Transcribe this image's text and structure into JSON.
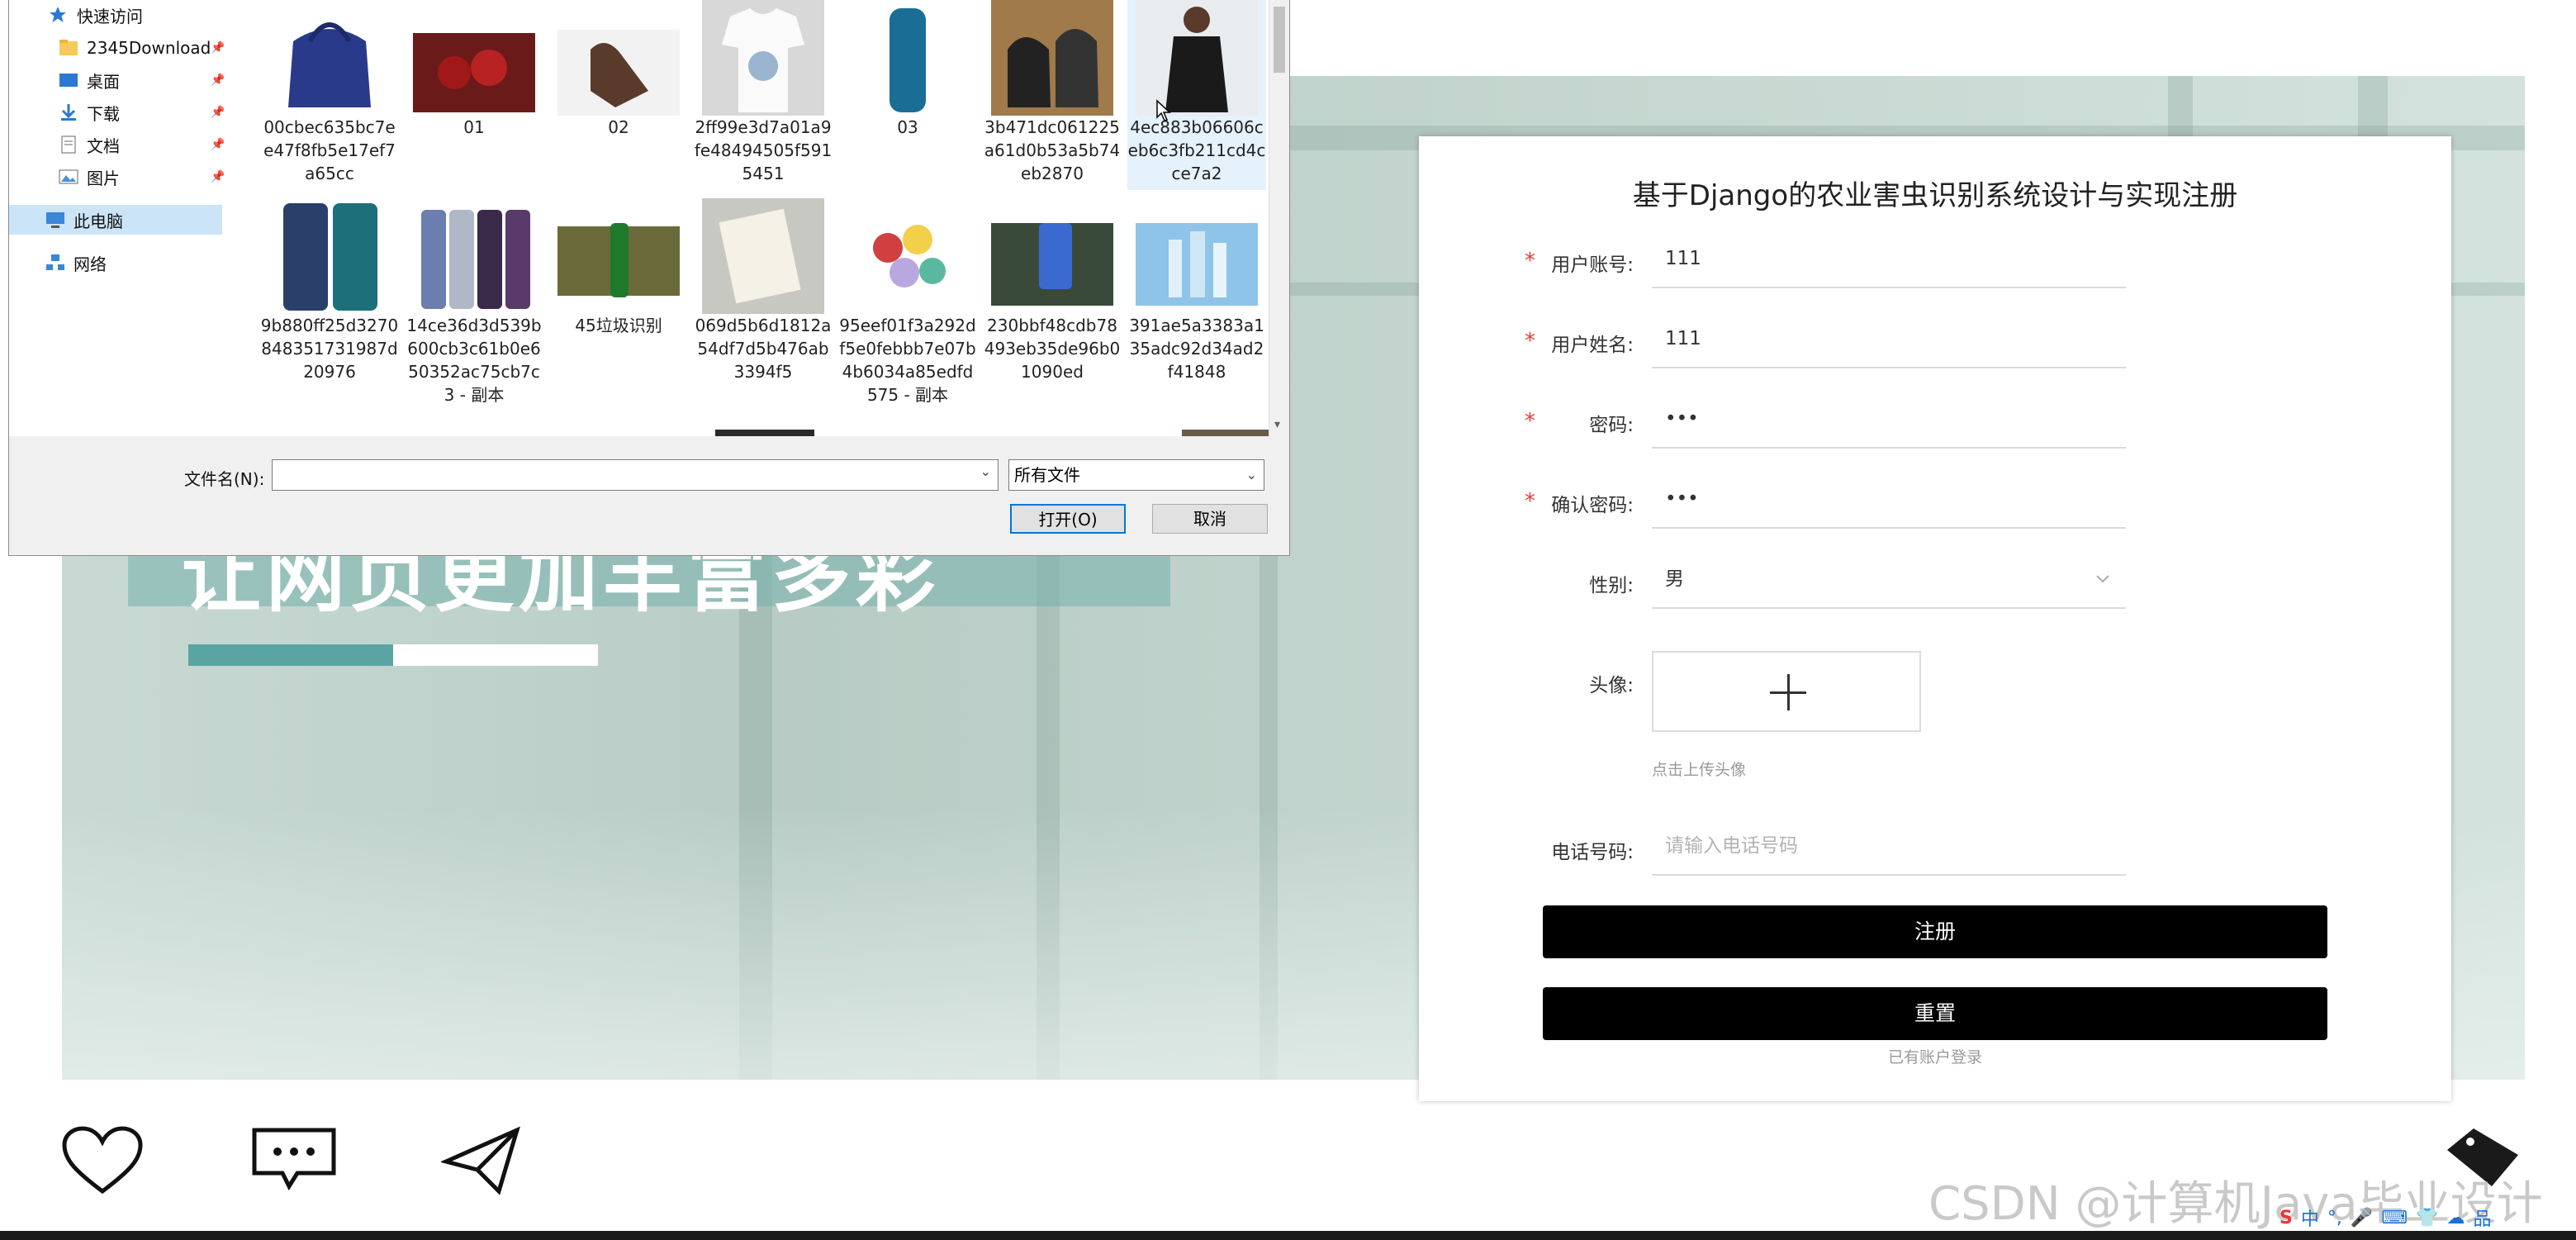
{
  "banner": {
    "slogan": "让网页更加丰富多彩"
  },
  "register": {
    "title": "基于Django的农业害虫识别系统设计与实现注册",
    "fields": [
      {
        "label": "用户账号:",
        "value": "111",
        "required": true
      },
      {
        "label": "用户姓名:",
        "value": "111",
        "required": true
      },
      {
        "label": "密码:",
        "value": "•••",
        "required": true
      },
      {
        "label": "确认密码:",
        "value": "•••",
        "required": true
      },
      {
        "label": "性别:",
        "value": "男",
        "required": false
      }
    ],
    "avatar_label": "头像:",
    "avatar_hint": "点击上传头像",
    "phone_label": "电话号码:",
    "phone_placeholder": "请输入电话号码",
    "register_button": "注册",
    "reset_button": "重置",
    "login_link": "已有账户登录"
  },
  "dialog": {
    "nav": [
      {
        "label": "快速访问",
        "icon": "star-icon"
      },
      {
        "label": "2345Download",
        "icon": "folder-icon",
        "pinned": true
      },
      {
        "label": "桌面",
        "icon": "desktop-icon",
        "pinned": true
      },
      {
        "label": "下载",
        "icon": "download-icon",
        "pinned": true
      },
      {
        "label": "文档",
        "icon": "document-icon",
        "pinned": true
      },
      {
        "label": "图片",
        "icon": "picture-icon",
        "pinned": true
      },
      {
        "label": "此电脑",
        "icon": "computer-icon"
      },
      {
        "label": "网络",
        "icon": "network-icon"
      }
    ],
    "files": [
      {
        "name": "00cbec635bc7ee47f8fb5e17ef7a65cc",
        "thumb": "handbag"
      },
      {
        "name": "01",
        "thumb": "cherries"
      },
      {
        "name": "02",
        "thumb": "massage-chair"
      },
      {
        "name": "2ff99e3d7a01a9fe48494505f5915451",
        "thumb": "tshirt"
      },
      {
        "name": "03",
        "thumb": "bottle"
      },
      {
        "name": "3b471dc061225a61d0b53a5b74eb2870",
        "thumb": "shoes"
      },
      {
        "name": "4ec883b06606ceb6c3fb211cd4cce7a2",
        "thumb": "dress",
        "selected": true
      },
      {
        "name": "9b880ff25d3270848351731987d20976",
        "thumb": "phone-case"
      },
      {
        "name": "14ce36d3d539b600cb3c61b0e650352ac75cb7c3 - 副本",
        "thumb": "phones"
      },
      {
        "name": "45垃圾识别",
        "thumb": "green-bottle"
      },
      {
        "name": "069d5b6d1812a54df7d5b476ab3394f5",
        "thumb": "notebooks"
      },
      {
        "name": "95eef01f3a292df5e0febbb7e07b4b6034a85edfd575 - 副本",
        "thumb": "iphones"
      },
      {
        "name": "230bbf48cdb78493eb35de96b01090ed",
        "thumb": "hand-phone"
      },
      {
        "name": "391ae5a3383a135adc92d34ad2f41848",
        "thumb": "cosmetics"
      }
    ],
    "filename_label": "文件名(N):",
    "filename_value": "",
    "filetype_value": "所有文件",
    "open_button": "打开(O)",
    "cancel_button": "取消"
  },
  "watermark": "CSDN @计算机Java毕业设计",
  "tray": [
    "中",
    "°,",
    "🎤",
    "⌨",
    "👕",
    "☁",
    "品"
  ]
}
